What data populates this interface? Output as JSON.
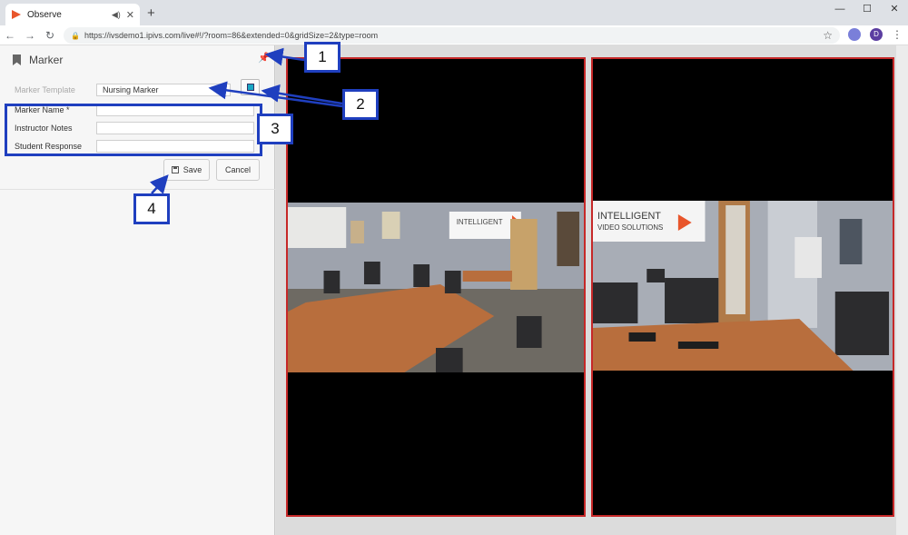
{
  "browser": {
    "tab_title": "Observe",
    "url": "https://ivsdemo1.ipivs.com/live#!/?room=86&extended=0&gridSize=2&type=room",
    "avatar_initial": "D"
  },
  "panel": {
    "title": "Marker",
    "fields": {
      "template_label": "Marker Template",
      "template_value": "Nursing Marker",
      "name_label": "Marker Name",
      "required_mark": "*",
      "instructor_notes_label": "Instructor Notes",
      "student_response_label": "Student Response"
    },
    "save_label": "Save",
    "cancel_label": "Cancel"
  },
  "video": {
    "left_sign": "INTELLIGENT",
    "right_sign_line1": "INTELLIGENT",
    "right_sign_line2": "VIDEO SOLUTIONS"
  },
  "callouts": [
    "1",
    "2",
    "3",
    "4"
  ],
  "colors": {
    "accent_blue": "#1f3fbf",
    "tile_border": "#c62828",
    "marker_swatch": "#1aa7c4"
  }
}
